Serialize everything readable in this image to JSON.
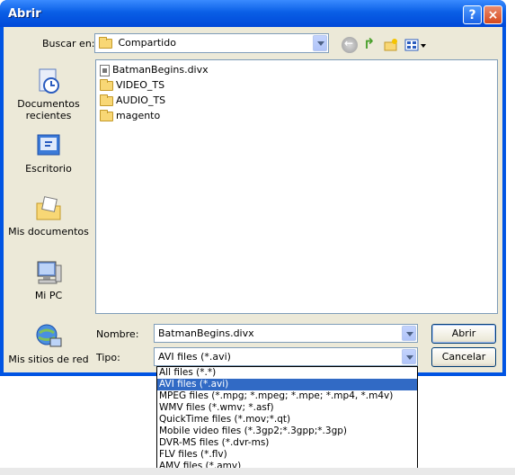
{
  "window": {
    "title": "Abrir",
    "help_label": "?",
    "close_label": "×"
  },
  "lookin": {
    "label": "Buscar en:",
    "value": "Compartido"
  },
  "places": [
    {
      "label": "Documentos recientes",
      "icon": "recent-documents-icon"
    },
    {
      "label": "Escritorio",
      "icon": "desktop-icon"
    },
    {
      "label": "Mis documentos",
      "icon": "my-documents-icon"
    },
    {
      "label": "Mi PC",
      "icon": "my-computer-icon"
    },
    {
      "label": "Mis sitios de red",
      "icon": "network-places-icon"
    }
  ],
  "files": [
    {
      "name": "BatmanBegins.divx",
      "icon": "file-icon"
    },
    {
      "name": "VIDEO_TS",
      "icon": "folder-icon"
    },
    {
      "name": "AUDIO_TS",
      "icon": "folder-icon"
    },
    {
      "name": "magento",
      "icon": "folder-icon"
    }
  ],
  "filename": {
    "label": "Nombre:",
    "value": "BatmanBegins.divx"
  },
  "filetype": {
    "label": "Tipo:",
    "value": "AVI files (*.avi)",
    "options": [
      "All files (*.*)",
      "AVI files (*.avi)",
      "MPEG files (*.mpg; *.mpeg; *.mpe; *.mp4, *.m4v)",
      "WMV files (*.wmv; *.asf)",
      "QuickTime files (*.mov;*.qt)",
      "Mobile video files (*.3gp2;*.3gpp;*.3gp)",
      "DVR-MS files (*.dvr-ms)",
      "FLV files (*.flv)",
      "AMV files (*.amv)"
    ],
    "selected_index": 1
  },
  "buttons": {
    "open": "Abrir",
    "cancel": "Cancelar"
  },
  "colors": {
    "titlebar": "#0054e3",
    "dialog_bg": "#ece9d8",
    "selection": "#316ac5"
  }
}
